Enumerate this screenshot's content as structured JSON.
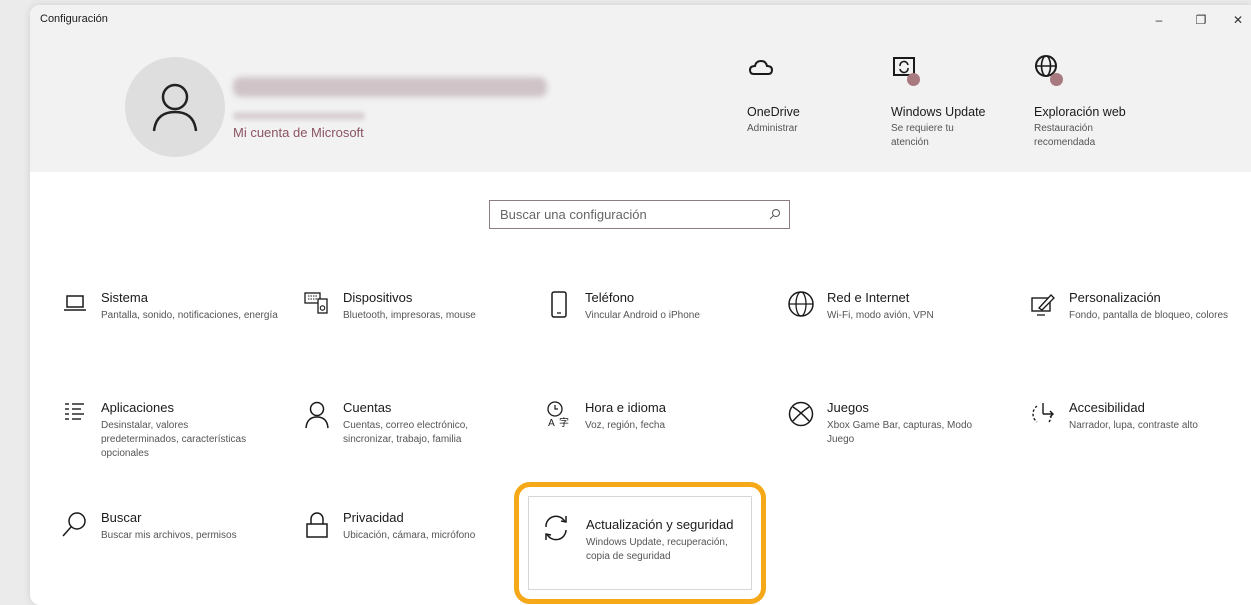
{
  "window": {
    "title": "Configuración",
    "controls": {
      "minimize": "–",
      "maximize": "❐",
      "close": "✕"
    }
  },
  "account": {
    "link": "Mi cuenta de Microsoft"
  },
  "status_cards": [
    {
      "title": "OneDrive",
      "sub": "Administrar"
    },
    {
      "title": "Windows Update",
      "sub": "Se requiere tu atención"
    },
    {
      "title": "Exploración web",
      "sub": "Restauración recomendada"
    }
  ],
  "search": {
    "placeholder": "Buscar una configuración"
  },
  "tiles": [
    {
      "title": "Sistema",
      "sub": "Pantalla, sonido, notificaciones, energía"
    },
    {
      "title": "Dispositivos",
      "sub": "Bluetooth, impresoras, mouse"
    },
    {
      "title": "Teléfono",
      "sub": "Vincular Android o iPhone"
    },
    {
      "title": "Red e Internet",
      "sub": "Wi-Fi, modo avión, VPN"
    },
    {
      "title": "Personalización",
      "sub": "Fondo, pantalla de bloqueo, colores"
    },
    {
      "title": "Aplicaciones",
      "sub": "Desinstalar, valores predeterminados, características opcionales"
    },
    {
      "title": "Cuentas",
      "sub": "Cuentas, correo electrónico, sincronizar, trabajo, familia"
    },
    {
      "title": "Hora e idioma",
      "sub": "Voz, región, fecha"
    },
    {
      "title": "Juegos",
      "sub": "Xbox Game Bar, capturas, Modo Juego"
    },
    {
      "title": "Accesibilidad",
      "sub": "Narrador, lupa, contraste alto"
    },
    {
      "title": "Buscar",
      "sub": "Buscar mis archivos, permisos"
    },
    {
      "title": "Privacidad",
      "sub": "Ubicación, cámara, micrófono"
    },
    {
      "title": "Actualización y seguridad",
      "sub": "Windows Update, recuperación, copia de seguridad"
    }
  ],
  "colors": {
    "accent": "#8b5463",
    "badge": "#a8797f",
    "highlight": "#f5a818"
  }
}
